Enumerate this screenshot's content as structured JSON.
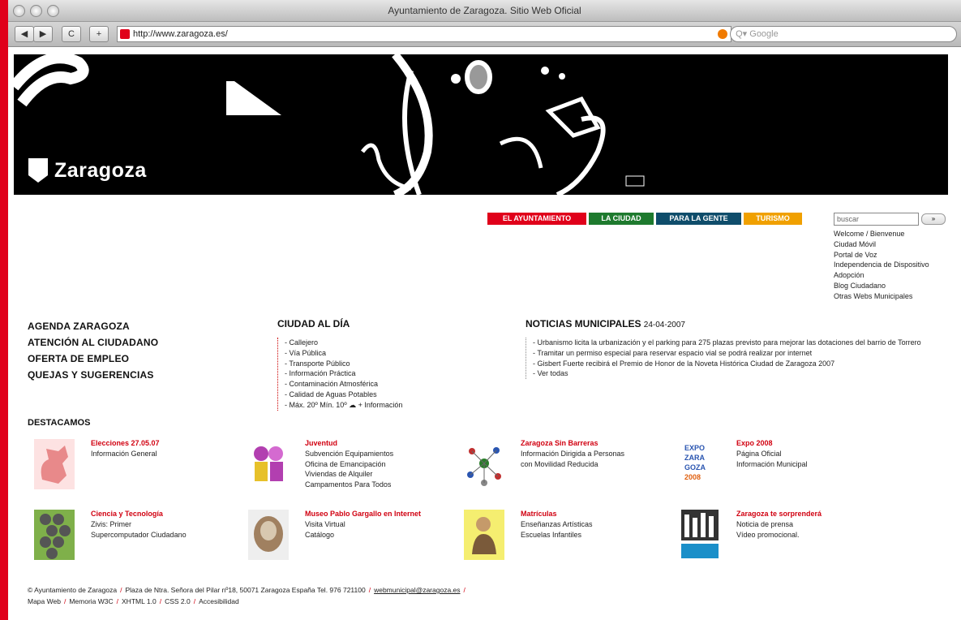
{
  "window": {
    "title": "Ayuntamiento de Zaragoza. Sitio Web Oficial"
  },
  "toolbar": {
    "back": "◀",
    "forward": "▶",
    "reload": "C",
    "add": "+",
    "url": "http://www.zaragoza.es/",
    "search_placeholder": "Q▾ Google"
  },
  "banner": {
    "logo_text": "Zaragoza"
  },
  "nav": [
    {
      "label": "EL AYUNTAMIENTO",
      "color": "#e0001a"
    },
    {
      "label": "LA CIUDAD",
      "color": "#1e7a2e"
    },
    {
      "label": "PARA LA GENTE",
      "color": "#0f4d6b"
    },
    {
      "label": "TURISMO",
      "color": "#f0a000"
    }
  ],
  "side": {
    "search_placeholder": "buscar",
    "search_button": "»",
    "links": [
      "Welcome / Bienvenue",
      "Ciudad Móvil",
      "Portal de Voz",
      "Independencia de Dispositivo",
      "Adopción",
      "Blog Ciudadano",
      "Otras Webs Municipales"
    ]
  },
  "left_menu": [
    "AGENDA ZARAGOZA",
    "ATENCIÓN AL CIUDADANO",
    "OFERTA DE EMPLEO",
    "QUEJAS Y SUGERENCIAS"
  ],
  "ciudad": {
    "heading": "CIUDAD AL DÍA",
    "items": [
      "Callejero",
      "Vía Pública",
      "Transporte Público",
      "Información Práctica",
      "Contaminación Atmosférica",
      "Calidad de Aguas Potables",
      "Máx. 20º Mín. 10º  ☁  + Información"
    ]
  },
  "noticias": {
    "heading": "NOTICIAS MUNICIPALES",
    "date": "24-04-2007",
    "items": [
      "Urbanismo licita la urbanización y el parking para 275 plazas previsto para mejorar las dotaciones del barrio de Torrero",
      "Tramitar un permiso especial para reservar espacio vial se podrá realizar por internet",
      "Gisbert Fuerte recibirá el Premio de Honor de la Noveta Histórica Ciudad de Zaragoza 2007",
      "Ver todas"
    ]
  },
  "destacamos": {
    "heading": "DESTACAMOS",
    "cards": [
      {
        "icon": "lion-icon",
        "title": "Elecciones 27.05.07",
        "lines": [
          "Información General"
        ]
      },
      {
        "icon": "youth-icon",
        "title": "Juventud",
        "lines": [
          "Subvención Equipamientos",
          "Oficina de Emancipación",
          "Viviendas de Alquiler",
          "Campamentos Para Todos"
        ]
      },
      {
        "icon": "network-icon",
        "title": "Zaragoza Sin Barreras",
        "lines": [
          "Información Dirigida a Personas",
          "con Movilidad Reducida"
        ]
      },
      {
        "icon": "expo-icon",
        "title": "Expo 2008",
        "lines": [
          "Página Oficial",
          "Información Municipal"
        ]
      },
      {
        "icon": "hexagon-icon",
        "title": "Ciencia y Tecnología",
        "lines": [
          "Zivis: Primer",
          "Supercomputador Ciudadano"
        ]
      },
      {
        "icon": "sculpture-icon",
        "title": "Museo Pablo Gargallo en Internet",
        "lines": [
          "Visita Virtual",
          "Catálogo"
        ]
      },
      {
        "icon": "student-icon",
        "title": "Matrículas",
        "lines": [
          "Enseñanzas Artísticas",
          "Escuelas Infantiles"
        ]
      },
      {
        "icon": "city-icon",
        "title": "Zaragoza te sorprenderá",
        "lines": [
          "Noticia de prensa",
          "Vídeo promocional."
        ]
      }
    ]
  },
  "footer": {
    "line1": [
      "© Ayuntamiento de Zaragoza",
      "Plaza de Ntra. Señora del Pilar nº18, 50071 Zaragoza España Tel. 976 721100",
      "webmunicipal@zaragoza.es"
    ],
    "line2": [
      "Mapa Web",
      "Memoria W3C",
      "XHTML 1.0",
      "CSS 2.0",
      "Accesibilidad"
    ]
  }
}
